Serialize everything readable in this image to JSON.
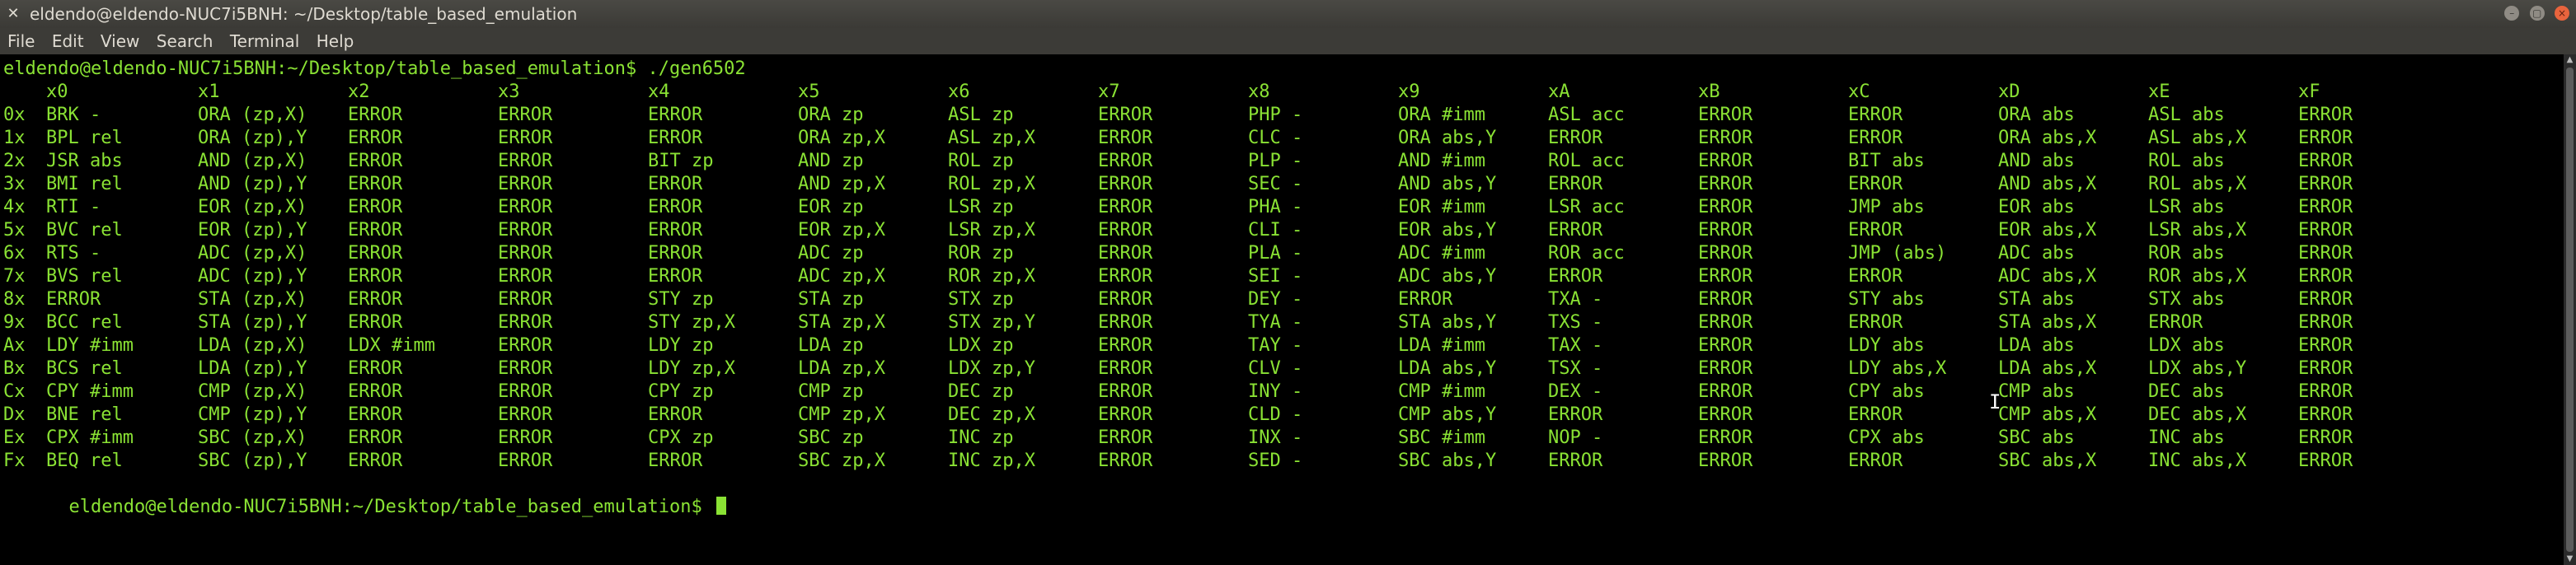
{
  "window": {
    "title": "eldendo@eldendo-NUC7i5BNH: ~/Desktop/table_based_emulation",
    "title_icon": "terminal-icon",
    "buttons": {
      "minimize": "–",
      "maximize": "▢",
      "close": "×"
    }
  },
  "menu": [
    "File",
    "Edit",
    "View",
    "Search",
    "Terminal",
    "Help"
  ],
  "terminal": {
    "prompt_command": "eldendo@eldendo-NUC7i5BNH:~/Desktop/table_based_emulation$ ./gen6502",
    "header": [
      "x0",
      "x1",
      "x2",
      "x3",
      "x4",
      "x5",
      "x6",
      "x7",
      "x8",
      "x9",
      "xA",
      "xB",
      "xC",
      "xD",
      "xE",
      "xF"
    ],
    "rows": [
      {
        "label": "0x",
        "cells": [
          "BRK -",
          "ORA (zp,X)",
          "ERROR",
          "ERROR",
          "ERROR",
          "ORA zp",
          "ASL zp",
          "ERROR",
          "PHP -",
          "ORA #imm",
          "ASL acc",
          "ERROR",
          "ERROR",
          "ORA abs",
          "ASL abs",
          "ERROR"
        ]
      },
      {
        "label": "1x",
        "cells": [
          "BPL rel",
          "ORA (zp),Y",
          "ERROR",
          "ERROR",
          "ERROR",
          "ORA zp,X",
          "ASL zp,X",
          "ERROR",
          "CLC -",
          "ORA abs,Y",
          "ERROR",
          "ERROR",
          "ERROR",
          "ORA abs,X",
          "ASL abs,X",
          "ERROR"
        ]
      },
      {
        "label": "2x",
        "cells": [
          "JSR abs",
          "AND (zp,X)",
          "ERROR",
          "ERROR",
          "BIT zp",
          "AND zp",
          "ROL zp",
          "ERROR",
          "PLP -",
          "AND #imm",
          "ROL acc",
          "ERROR",
          "BIT abs",
          "AND abs",
          "ROL abs",
          "ERROR"
        ]
      },
      {
        "label": "3x",
        "cells": [
          "BMI rel",
          "AND (zp),Y",
          "ERROR",
          "ERROR",
          "ERROR",
          "AND zp,X",
          "ROL zp,X",
          "ERROR",
          "SEC -",
          "AND abs,Y",
          "ERROR",
          "ERROR",
          "ERROR",
          "AND abs,X",
          "ROL abs,X",
          "ERROR"
        ]
      },
      {
        "label": "4x",
        "cells": [
          "RTI -",
          "EOR (zp,X)",
          "ERROR",
          "ERROR",
          "ERROR",
          "EOR zp",
          "LSR zp",
          "ERROR",
          "PHA -",
          "EOR #imm",
          "LSR acc",
          "ERROR",
          "JMP abs",
          "EOR abs",
          "LSR abs",
          "ERROR"
        ]
      },
      {
        "label": "5x",
        "cells": [
          "BVC rel",
          "EOR (zp),Y",
          "ERROR",
          "ERROR",
          "ERROR",
          "EOR zp,X",
          "LSR zp,X",
          "ERROR",
          "CLI -",
          "EOR abs,Y",
          "ERROR",
          "ERROR",
          "ERROR",
          "EOR abs,X",
          "LSR abs,X",
          "ERROR"
        ]
      },
      {
        "label": "6x",
        "cells": [
          "RTS -",
          "ADC (zp,X)",
          "ERROR",
          "ERROR",
          "ERROR",
          "ADC zp",
          "ROR zp",
          "ERROR",
          "PLA -",
          "ADC #imm",
          "ROR acc",
          "ERROR",
          "JMP (abs)",
          "ADC abs",
          "ROR abs",
          "ERROR"
        ]
      },
      {
        "label": "7x",
        "cells": [
          "BVS rel",
          "ADC (zp),Y",
          "ERROR",
          "ERROR",
          "ERROR",
          "ADC zp,X",
          "ROR zp,X",
          "ERROR",
          "SEI -",
          "ADC abs,Y",
          "ERROR",
          "ERROR",
          "ERROR",
          "ADC abs,X",
          "ROR abs,X",
          "ERROR"
        ]
      },
      {
        "label": "8x",
        "cells": [
          "ERROR",
          "STA (zp,X)",
          "ERROR",
          "ERROR",
          "STY zp",
          "STA zp",
          "STX zp",
          "ERROR",
          "DEY -",
          "ERROR",
          "TXA -",
          "ERROR",
          "STY abs",
          "STA abs",
          "STX abs",
          "ERROR"
        ]
      },
      {
        "label": "9x",
        "cells": [
          "BCC rel",
          "STA (zp),Y",
          "ERROR",
          "ERROR",
          "STY zp,X",
          "STA zp,X",
          "STX zp,Y",
          "ERROR",
          "TYA -",
          "STA abs,Y",
          "TXS -",
          "ERROR",
          "ERROR",
          "STA abs,X",
          "ERROR",
          "ERROR"
        ]
      },
      {
        "label": "Ax",
        "cells": [
          "LDY #imm",
          "LDA (zp,X)",
          "LDX #imm",
          "ERROR",
          "LDY zp",
          "LDA zp",
          "LDX zp",
          "ERROR",
          "TAY -",
          "LDA #imm",
          "TAX -",
          "ERROR",
          "LDY abs",
          "LDA abs",
          "LDX abs",
          "ERROR"
        ]
      },
      {
        "label": "Bx",
        "cells": [
          "BCS rel",
          "LDA (zp),Y",
          "ERROR",
          "ERROR",
          "LDY zp,X",
          "LDA zp,X",
          "LDX zp,Y",
          "ERROR",
          "CLV -",
          "LDA abs,Y",
          "TSX -",
          "ERROR",
          "LDY abs,X",
          "LDA abs,X",
          "LDX abs,Y",
          "ERROR"
        ]
      },
      {
        "label": "Cx",
        "cells": [
          "CPY #imm",
          "CMP (zp,X)",
          "ERROR",
          "ERROR",
          "CPY zp",
          "CMP zp",
          "DEC zp",
          "ERROR",
          "INY -",
          "CMP #imm",
          "DEX -",
          "ERROR",
          "CPY abs",
          "CMP abs",
          "DEC abs",
          "ERROR"
        ]
      },
      {
        "label": "Dx",
        "cells": [
          "BNE rel",
          "CMP (zp),Y",
          "ERROR",
          "ERROR",
          "ERROR",
          "CMP zp,X",
          "DEC zp,X",
          "ERROR",
          "CLD -",
          "CMP abs,Y",
          "ERROR",
          "ERROR",
          "ERROR",
          "CMP abs,X",
          "DEC abs,X",
          "ERROR"
        ]
      },
      {
        "label": "Ex",
        "cells": [
          "CPX #imm",
          "SBC (zp,X)",
          "ERROR",
          "ERROR",
          "CPX zp",
          "SBC zp",
          "INC zp",
          "ERROR",
          "INX -",
          "SBC #imm",
          "NOP -",
          "ERROR",
          "CPX abs",
          "SBC abs",
          "INC abs",
          "ERROR"
        ]
      },
      {
        "label": "Fx",
        "cells": [
          "BEQ rel",
          "SBC (zp),Y",
          "ERROR",
          "ERROR",
          "ERROR",
          "SBC zp,X",
          "INC zp,X",
          "ERROR",
          "SED -",
          "SBC abs,Y",
          "ERROR",
          "ERROR",
          "ERROR",
          "SBC abs,X",
          "INC abs,X",
          "ERROR"
        ]
      }
    ],
    "final_prompt": "eldendo@eldendo-NUC7i5BNH:~/Desktop/table_based_emulation$ "
  },
  "colors": {
    "terminal_background": "#000000",
    "terminal_text": "#8ae234",
    "titlebar": "#3c3b37",
    "close_button": "#e9643d"
  }
}
